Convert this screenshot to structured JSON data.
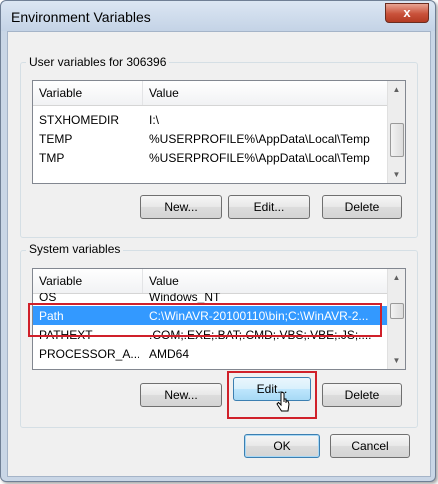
{
  "window": {
    "title": "Environment Variables",
    "close_glyph": "x"
  },
  "user_vars": {
    "group_label": "User variables for 306396",
    "columns": [
      "Variable",
      "Value"
    ],
    "rows": [
      {
        "variable": "STXHOMEDIR",
        "value": "I:\\"
      },
      {
        "variable": "TEMP",
        "value": "%USERPROFILE%\\AppData\\Local\\Temp"
      },
      {
        "variable": "TMP",
        "value": "%USERPROFILE%\\AppData\\Local\\Temp"
      }
    ],
    "buttons": {
      "new": "New...",
      "edit": "Edit...",
      "delete": "Delete"
    }
  },
  "system_vars": {
    "group_label": "System variables",
    "columns": [
      "Variable",
      "Value"
    ],
    "rows": [
      {
        "variable": "OS",
        "value": "Windows_NT"
      },
      {
        "variable": "Path",
        "value": "C:\\WinAVR-20100110\\bin;C:\\WinAVR-2...",
        "selected": true
      },
      {
        "variable": "PATHEXT",
        "value": ".COM;.EXE;.BAT;.CMD;.VBS;.VBE;.JS;...."
      },
      {
        "variable": "PROCESSOR_A...",
        "value": "AMD64"
      }
    ],
    "buttons": {
      "new": "New...",
      "edit": "Edit...",
      "delete": "Delete"
    }
  },
  "dialog_buttons": {
    "ok": "OK",
    "cancel": "Cancel"
  },
  "colors": {
    "highlight_box": "#d0202a",
    "selection": "#3399ff"
  },
  "icons": {
    "close": "close-icon",
    "cursor": "mouse-pointer-icon",
    "scroll_up": "scroll-up-arrow-icon",
    "scroll_down": "scroll-down-arrow-icon"
  }
}
